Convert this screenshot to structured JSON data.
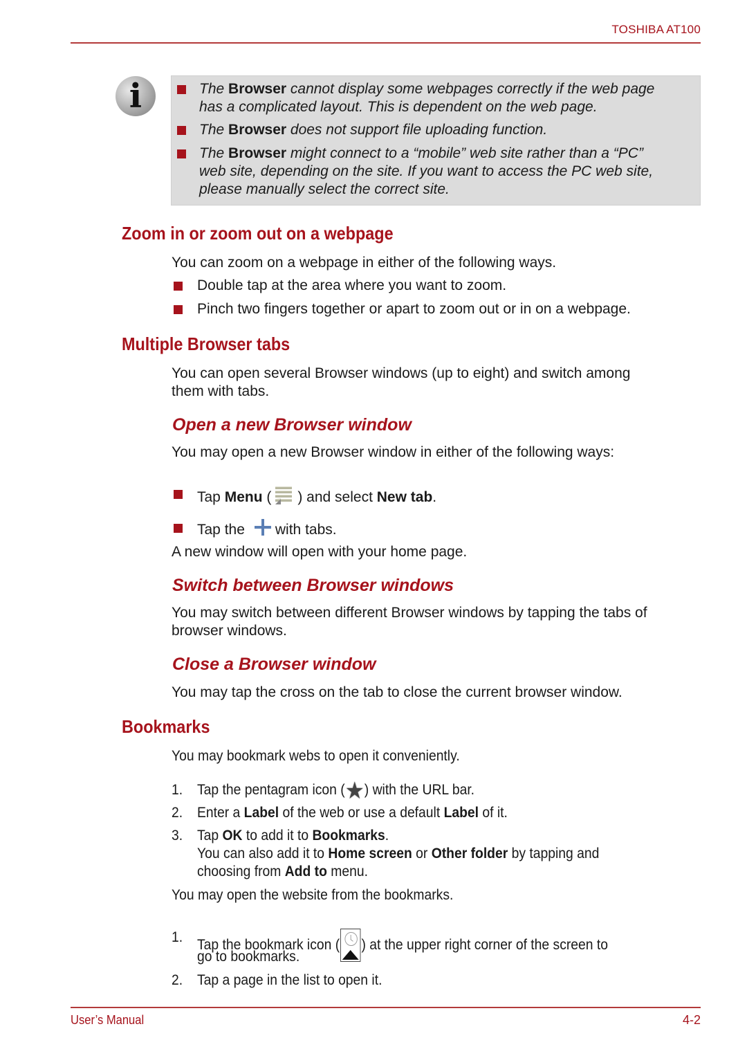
{
  "header": {
    "title": "TOSHIBA AT100"
  },
  "note": {
    "icon": "info-icon",
    "items": [
      {
        "pre": "The ",
        "bold": "Browser",
        "line1": " cannot display some webpages correctly if the web page",
        "line2": "has a complicated layout. This is dependent on the web page."
      },
      {
        "pre": "The ",
        "bold": "Browser",
        "line1": " does not support file uploading function."
      },
      {
        "pre": "The ",
        "bold": "Browser",
        "line1": " might connect to a “mobile” web site rather than a “PC”",
        "line2": "web site, depending on the site. If you want to access the PC web site,",
        "line3": "please manually select the correct site."
      }
    ]
  },
  "zoom_section": {
    "heading": "Zoom in or zoom out on a webpage",
    "intro": "You can zoom on a webpage in either of the following ways.",
    "bullets": [
      "Double tap at the area where you want to zoom.",
      "Pinch two fingers together or apart to zoom out or in on a webpage."
    ]
  },
  "tabs_section": {
    "heading": "Multiple Browser tabs",
    "intro_line1": "You can open several Browser windows (up to eight) and switch among",
    "intro_line2": "them with tabs."
  },
  "open_window": {
    "heading": "Open a new Browser window",
    "intro": "You may open a new Browser window in either of the following ways:",
    "bullet1": {
      "t1": "Tap ",
      "b1": "Menu",
      "t2": " (",
      "icon": "menu-icon",
      "t3": ") and select ",
      "b2": "New tab",
      "t4": "."
    },
    "bullet2": {
      "t1": "Tap the",
      "icon": "plus-icon",
      "t2": "with tabs."
    },
    "after": "A new window will open with your home page."
  },
  "switch_window": {
    "heading": "Switch between Browser windows",
    "line1": "You may switch between different Browser windows by tapping the tabs of",
    "line2": "browser windows."
  },
  "close_window": {
    "heading": "Close a Browser window",
    "text": "You may tap the cross on the tab to close the current browser window."
  },
  "bookmarks": {
    "heading": "Bookmarks",
    "intro": "You may bookmark webs to open it conveniently.",
    "steps": [
      {
        "num": "1.",
        "t1": "Tap the pentagram icon (",
        "icon": "star-icon",
        "t2": ") with the URL bar."
      },
      {
        "num": "2.",
        "t1": "Enter a ",
        "b1": "Label",
        "t2": " of the web or use a default ",
        "b2": "Label",
        "t3": " of it."
      },
      {
        "num": "3.",
        "t1": "Tap ",
        "b1": "OK",
        "t2": " to add it to ",
        "b2": "Bookmarks",
        "t3": ".",
        "sub1_t1": "You can also add it to ",
        "sub1_b1": "Home screen",
        "sub1_t2": " or ",
        "sub1_b2": "Other folder",
        "sub1_t3": " by tapping and",
        "sub2_t1": "choosing from ",
        "sub2_b1": "Add to",
        "sub2_t2": " menu."
      }
    ],
    "open_intro": "You may open the website from the bookmarks.",
    "open_steps": [
      {
        "num": "1.",
        "t1": "Tap the bookmark icon (",
        "icon": "bookmark-icon",
        "t2": ") at the upper right corner of the screen to",
        "line2": "go to bookmarks."
      },
      {
        "num": "2.",
        "t1": "Tap a page in the list to open it."
      }
    ]
  },
  "footer": {
    "left": "User’s Manual",
    "right": "4-2"
  },
  "colors": {
    "accent": "#a6131c",
    "note_bg": "#dcdcdc"
  }
}
